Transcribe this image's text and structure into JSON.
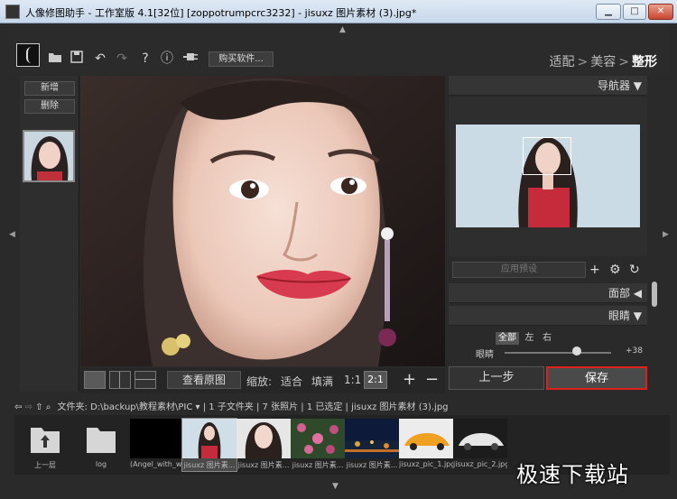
{
  "window": {
    "title": "人像修图助手 - 工作室版 4.1[32位] [zoppotrumpcrc3232] - jisuxz 图片素材 (3).jpg*",
    "controls": [
      "▁",
      "□",
      "✕"
    ]
  },
  "toolbar": {
    "buy_label": "购买软件...",
    "modes": [
      {
        "label": "适配",
        "active": false
      },
      {
        "label": "美容",
        "active": false
      },
      {
        "label": "整形",
        "active": true
      }
    ],
    "mode_separator": ">"
  },
  "left_panel": {
    "add_label": "新增",
    "delete_label": "删除"
  },
  "view_bar": {
    "compare_label": "查看原图",
    "zoom_label": "缩放:",
    "fit_label": "适合",
    "fill_label": "填满",
    "ratio_1_label": "1:1",
    "ratio_2_label": "2:1",
    "zoom_in": "+",
    "zoom_out": "−"
  },
  "right_panel": {
    "navigator_label": "导航器 ▼",
    "preset_placeholder": "应用预设",
    "face_label": "面部 ◀",
    "eyes_label": "眼睛 ▼",
    "eye_tabs": [
      {
        "label": "全部",
        "active": true
      },
      {
        "label": "左",
        "active": false
      },
      {
        "label": "右",
        "active": false
      }
    ],
    "slider_label": "眼睛",
    "slider_value": "+38",
    "slider_fraction": 0.68,
    "prev_label": "上一步",
    "save_label": "保存"
  },
  "path_bar": {
    "text": "文件夹: D:\\backup\\教程素材\\PIC ▾ | 1 子文件夹 | 7 张照片 | 1 已选定 | jisuxz 图片素材 (3).jpg"
  },
  "filmstrip": [
    {
      "label": "上一层",
      "kind": "up"
    },
    {
      "label": "log",
      "kind": "folder"
    },
    {
      "label": "(Angel_with_wi...",
      "kind": "black"
    },
    {
      "label": "jisuxz 图片素...",
      "kind": "portrait",
      "selected": true
    },
    {
      "label": "jisuxz 图片素...",
      "kind": "portrait2"
    },
    {
      "label": "jisuxz 图片素...",
      "kind": "flowers"
    },
    {
      "label": "jisuxz 图片素...",
      "kind": "night"
    },
    {
      "label": "jisuxz_pic_1.jpg",
      "kind": "car"
    },
    {
      "label": "jisuxz_pic_2.jpg",
      "kind": "car2"
    }
  ],
  "watermark": "极速下载站",
  "colors": {
    "save_border": "#e0201c",
    "panel_bg": "#2a2a2a"
  }
}
